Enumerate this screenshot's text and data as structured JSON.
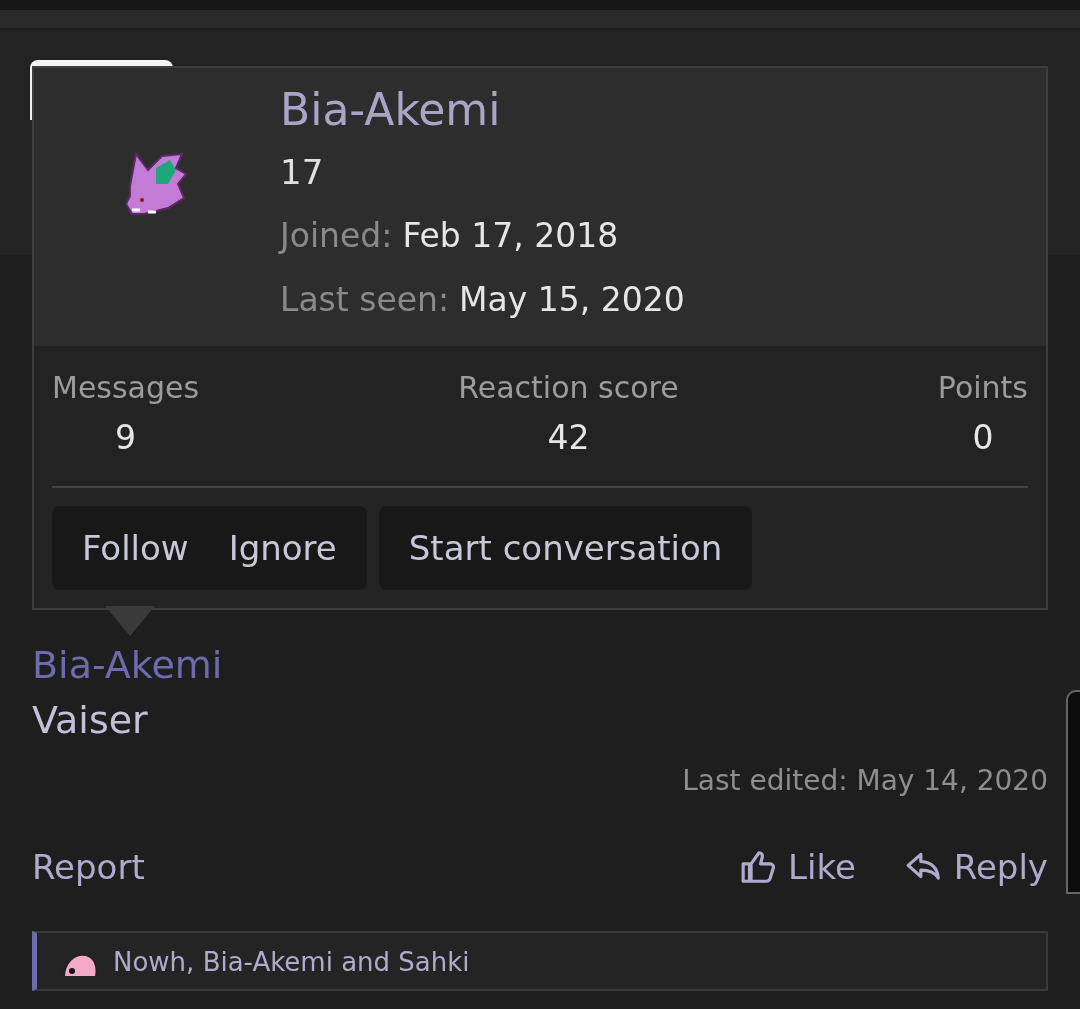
{
  "popup": {
    "username": "Bia-Akemi",
    "user_title": "17",
    "details": [
      {
        "label": "Joined:",
        "value": "Feb 17, 2018"
      },
      {
        "label": "Last seen:",
        "value": "May 15, 2020"
      }
    ],
    "stats": [
      {
        "label": "Messages",
        "value": "9"
      },
      {
        "label": "Reaction score",
        "value": "42"
      },
      {
        "label": "Points",
        "value": "0"
      }
    ],
    "button_group": [
      "Follow",
      "Ignore"
    ],
    "conversation_button": "Start conversation"
  },
  "post": {
    "mention": "Bia-Akemi",
    "text": "Vaiser",
    "last_edited": "Last edited: May 14, 2020",
    "actions": [
      {
        "kind": "report",
        "label": "Report"
      },
      {
        "kind": "like",
        "label": "Like"
      },
      {
        "kind": "reply",
        "label": "Reply"
      }
    ]
  },
  "reactions": {
    "text": "Nowh, Bia-Akemi and Sahki"
  }
}
